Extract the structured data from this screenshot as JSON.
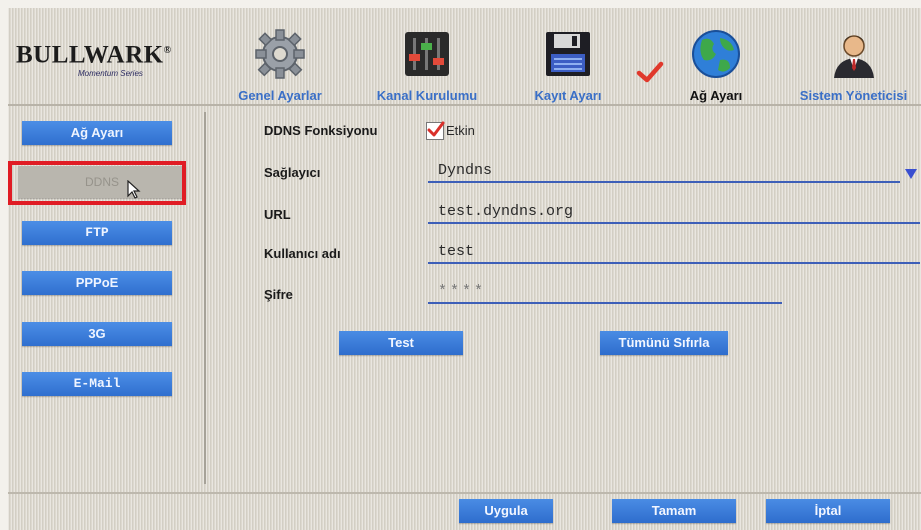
{
  "brand": {
    "name": "BULLWARK",
    "registered": "®",
    "tagline": "Momentum Series"
  },
  "nav_tabs": [
    {
      "label": "Genel Ayarlar",
      "icon": "gear-icon"
    },
    {
      "label": "Kanal Kurulumu",
      "icon": "sliders-icon"
    },
    {
      "label": "Kayıt Ayarı",
      "icon": "floppy-disk-icon"
    },
    {
      "label": "Ağ Ayarı",
      "icon": "globe-icon",
      "active": true
    },
    {
      "label": "Sistem Yöneticisi",
      "icon": "admin-user-icon"
    }
  ],
  "sidebar": {
    "header": "Ağ Ayarı",
    "items": [
      {
        "label": "DDNS",
        "state": "selected-disabled"
      },
      {
        "label": "FTP"
      },
      {
        "label": "PPPoE"
      },
      {
        "label": "3G"
      },
      {
        "label": "E-Mail"
      }
    ]
  },
  "form": {
    "ddns_function": {
      "label": "DDNS Fonksiyonu",
      "checkbox_label": "Etkin",
      "checked": true
    },
    "provider": {
      "label": "Sağlayıcı",
      "value": "Dyndns"
    },
    "url": {
      "label": "URL",
      "value": "test.dyndns.org"
    },
    "username": {
      "label": "Kullanıcı adı",
      "value": "test"
    },
    "password": {
      "label": "Şifre",
      "value": "****"
    }
  },
  "buttons": {
    "test": "Test",
    "reset_all": "Tümünü Sıfırla",
    "apply": "Uygula",
    "ok": "Tamam",
    "cancel": "İptal"
  },
  "colors": {
    "accent_blue": "#3a7bd8",
    "tab_label_blue": "#3a6fc7",
    "highlight_red": "#e01c24",
    "screen_bg": "#ddd9cf"
  }
}
